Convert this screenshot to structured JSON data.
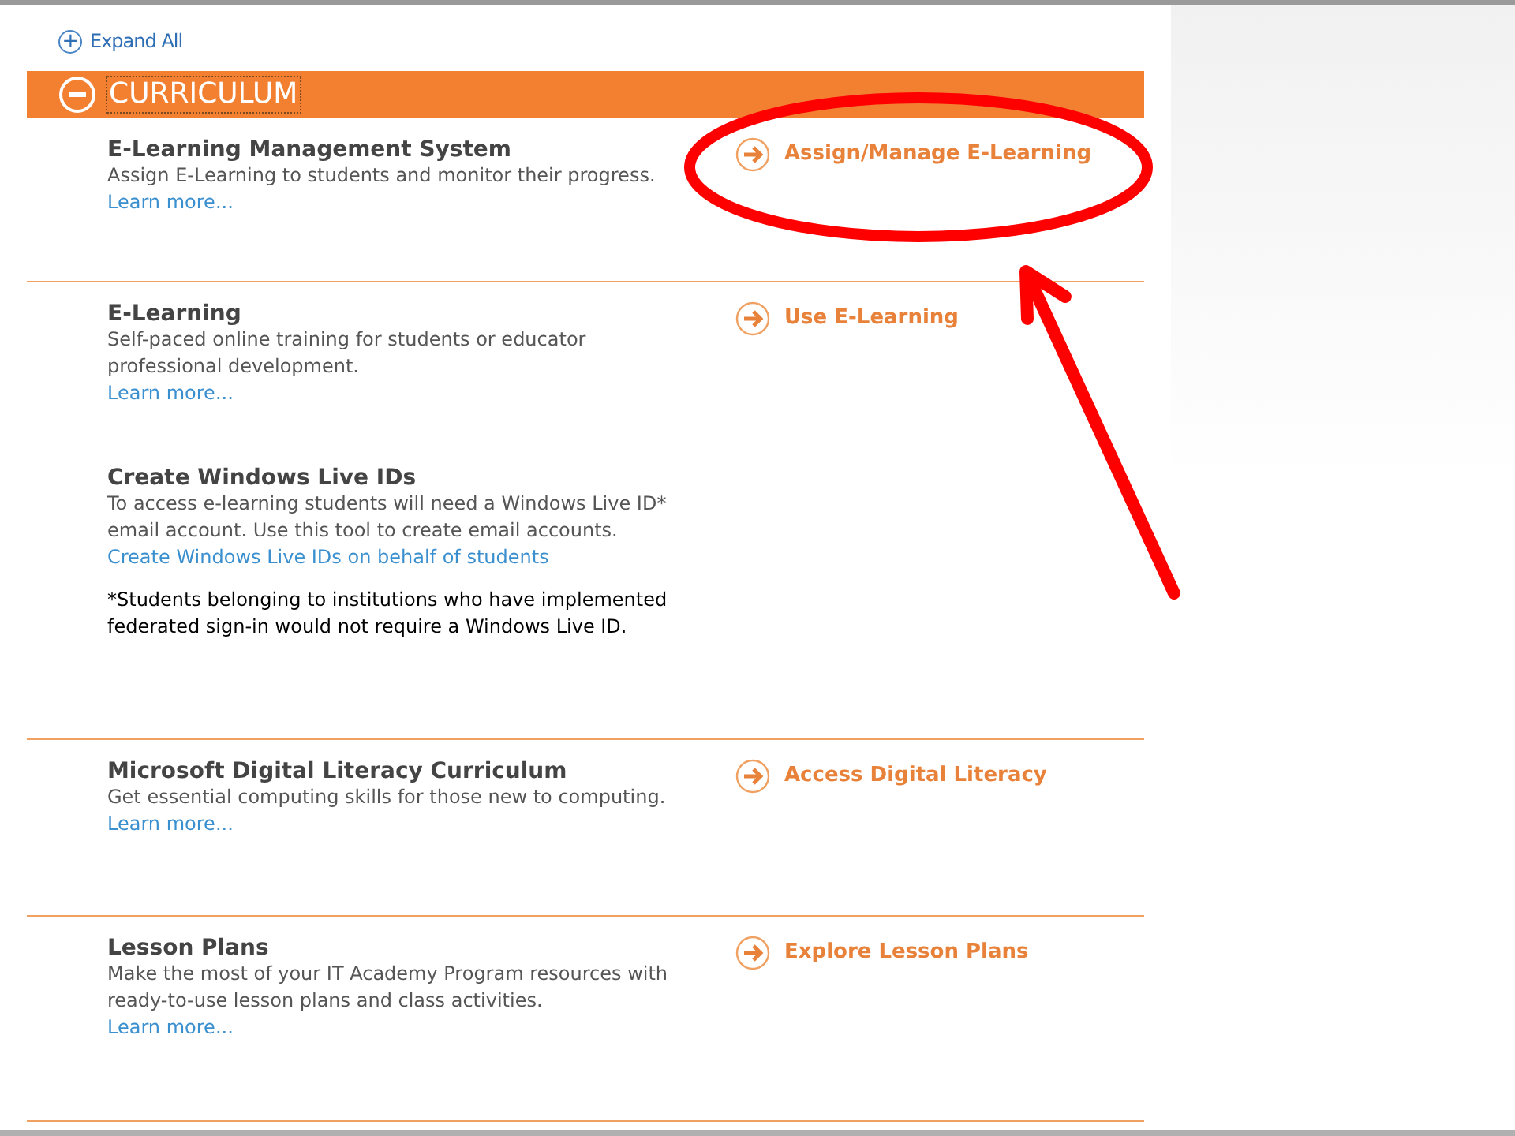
{
  "expand_all": {
    "icon": "+",
    "label": "Expand All"
  },
  "section_header": {
    "title": "CURRICULUM",
    "expanded": true
  },
  "sections": [
    {
      "items": [
        {
          "title": "E-Learning Management System",
          "description": "Assign E-Learning to students and monitor their progress.",
          "link": "Learn more..."
        }
      ],
      "action": "Assign/Manage E-Learning"
    },
    {
      "items": [
        {
          "title": "E-Learning",
          "description": "Self-paced online training for students or educator professional development.",
          "link": "Learn more..."
        },
        {
          "title": "Create Windows Live IDs",
          "description": "To access e-learning students will need a Windows Live ID* email account. Use this tool to create email accounts.",
          "link": "Create Windows Live IDs on behalf of students",
          "note": "*Students belonging to institutions who have implemented federated sign-in would not require a Windows Live ID."
        }
      ],
      "action": "Use E-Learning"
    },
    {
      "items": [
        {
          "title": "Microsoft Digital Literacy Curriculum",
          "description": "Get essential computing skills for those new to computing.",
          "link": "Learn more..."
        }
      ],
      "action": "Access Digital Literacy"
    },
    {
      "items": [
        {
          "title": "Lesson Plans",
          "description": "Make the most of your IT Academy Program resources with ready-to-use lesson plans and class activities.",
          "link": "Learn more..."
        }
      ],
      "action": "Explore Lesson Plans"
    }
  ]
}
